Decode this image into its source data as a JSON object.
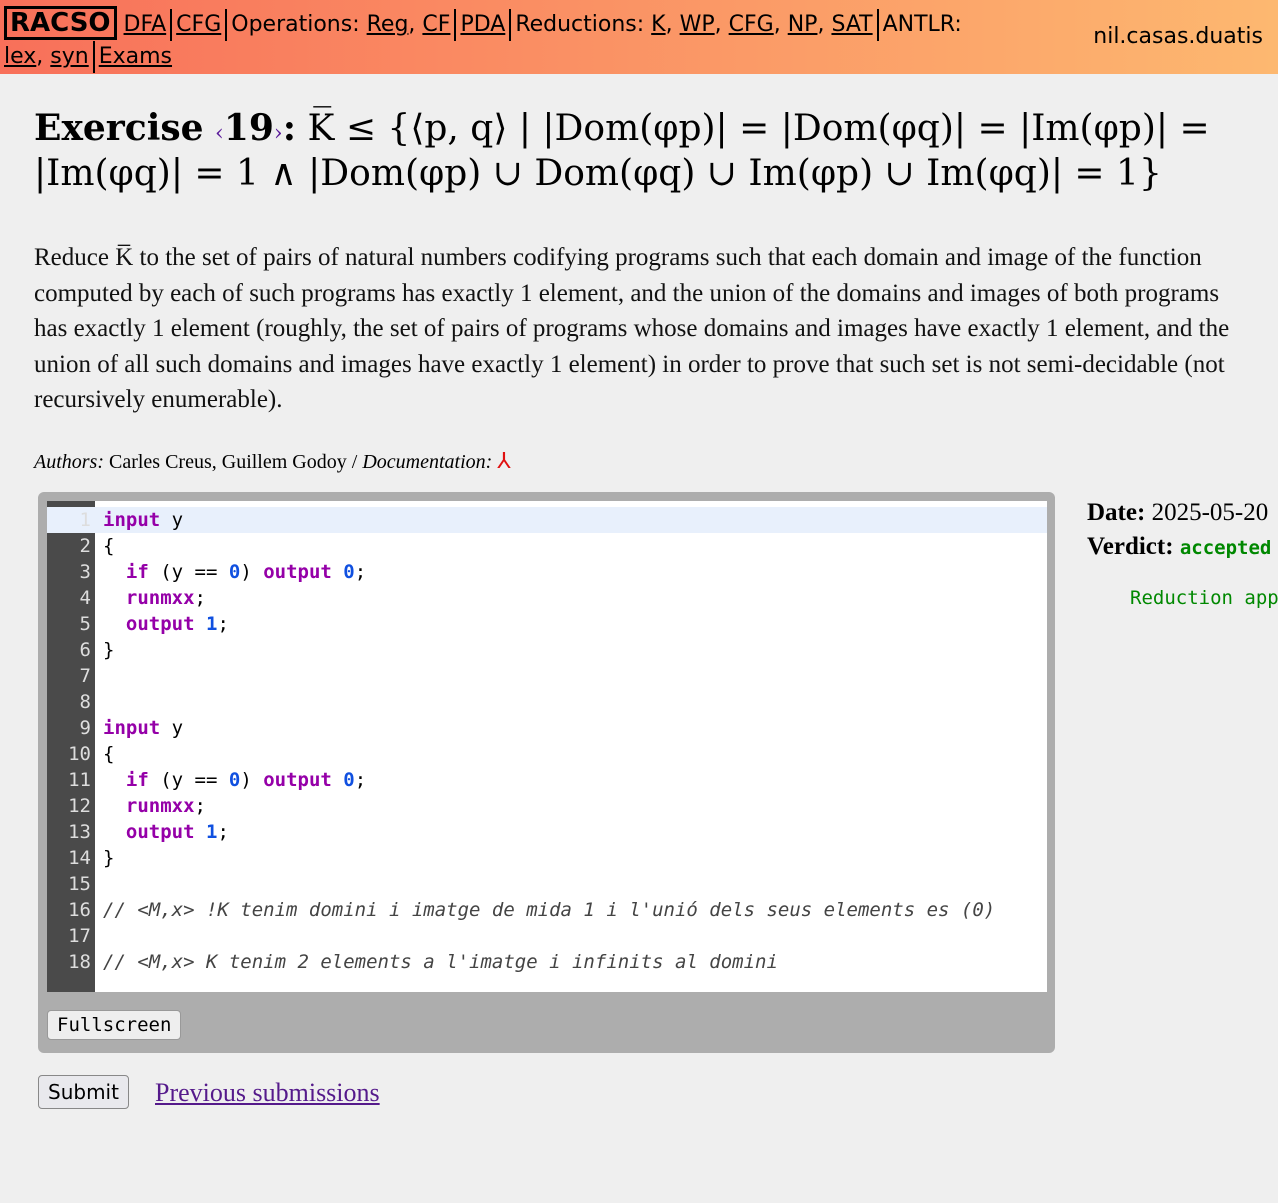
{
  "nav": {
    "logo": "RACSO",
    "dfa": "DFA",
    "cfg": "CFG",
    "operations": "Operations:",
    "reg": "Reg",
    "cf": "CF",
    "pda": "PDA",
    "reductions": "Reductions:",
    "k": "K",
    "wp": "WP",
    "cfg2": "CFG",
    "np": "NP",
    "sat": "SAT",
    "antlr": "ANTLR:",
    "lex": "lex",
    "syn": "syn",
    "exams": "Exams",
    "user": "nil.casas.duatis"
  },
  "exercise": {
    "label": "Exercise",
    "number": "19",
    "line1": "K̅ ≤ {⟨p, q⟩ | |Dom(φp)| = |Dom(φq)| = |Im(φp)| =",
    "line2": "|Im(φq)| = 1 ∧ |Dom(φp) ∪ Dom(φq) ∪ Im(φp) ∪ Im(φq)| = 1}"
  },
  "description": "Reduce K̅ to the set of pairs of natural numbers codifying programs such that each domain and image of the function computed by each of such programs has exactly 1 element, and the union of the domains and images of both programs has exactly 1 element (roughly, the set of pairs of programs whose domains and images have exactly 1 element, and the union of all such domains and images have exactly 1 element) in order to prove that such set is not semi-decidable (not recursively enumerable).",
  "authors": {
    "label": "Authors:",
    "names": "Carles Creus, Guillem Godoy /",
    "doc_label": "Documentation:"
  },
  "code_lines": [
    [
      [
        "kw",
        "input"
      ],
      [
        "",
        "y"
      ]
    ],
    [
      [
        "",
        "{"
      ]
    ],
    [
      [
        "",
        "  "
      ],
      [
        "kw",
        "if"
      ],
      [
        "",
        " (y == "
      ],
      [
        "num",
        "0"
      ],
      [
        "",
        ") "
      ],
      [
        "kw",
        "output"
      ],
      [
        "",
        " "
      ],
      [
        "num",
        "0"
      ],
      [
        "",
        ";"
      ]
    ],
    [
      [
        "",
        "  "
      ],
      [
        "kw",
        "runmxx"
      ],
      [
        "",
        ";"
      ]
    ],
    [
      [
        "",
        "  "
      ],
      [
        "kw",
        "output"
      ],
      [
        "",
        " "
      ],
      [
        "num",
        "1"
      ],
      [
        "",
        ";"
      ]
    ],
    [
      [
        "",
        "}"
      ]
    ],
    [],
    [],
    [
      [
        "kw",
        "input"
      ],
      [
        "",
        " y"
      ]
    ],
    [
      [
        "",
        "{"
      ]
    ],
    [
      [
        "",
        "  "
      ],
      [
        "kw",
        "if"
      ],
      [
        "",
        " (y == "
      ],
      [
        "num",
        "0"
      ],
      [
        "",
        ") "
      ],
      [
        "kw",
        "output"
      ],
      [
        "",
        " "
      ],
      [
        "num",
        "0"
      ],
      [
        "",
        ";"
      ]
    ],
    [
      [
        "",
        "  "
      ],
      [
        "kw",
        "runmxx"
      ],
      [
        "",
        ";"
      ]
    ],
    [
      [
        "",
        "  "
      ],
      [
        "kw",
        "output"
      ],
      [
        "",
        " "
      ],
      [
        "num",
        "1"
      ],
      [
        "",
        ";"
      ]
    ],
    [
      [
        "",
        "}"
      ]
    ],
    [],
    [
      [
        "cm",
        "// <M,x> !K tenim domini i imatge de mida 1 i l'unió dels seus elements es (0)"
      ]
    ],
    [],
    [
      [
        "cm",
        "// <M,x> K tenim 2 elements a l'imatge i infinits al domini"
      ]
    ]
  ],
  "fullscreen": "Fullscreen",
  "result": {
    "date_label": "Date:",
    "date": "2025-05-20",
    "verdict_label": "Verdict:",
    "verdict": "accepted",
    "message": "Reduction app"
  },
  "submit": "Submit",
  "previous": "Previous submissions"
}
